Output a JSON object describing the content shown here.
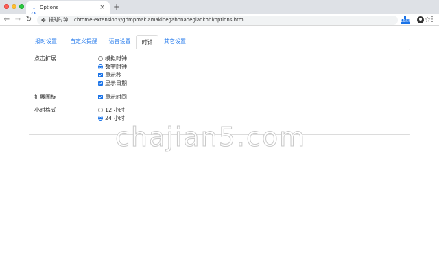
{
  "browser": {
    "tab_title": "Options",
    "tab_favicon": "-()-",
    "new_tab_label": "+",
    "tab_close_label": "×",
    "origin_label": "报时时钟",
    "url": "chrome-extension://gdmpmaklamakipegabonadegiaokhbl/options.html",
    "extension_badge": "16:55"
  },
  "icons": {
    "back": "arrow-left-icon",
    "forward": "arrow-right-icon",
    "reload": "reload-icon",
    "puzzle": "extension-puzzle-icon",
    "star": "star-icon",
    "account": "account-circle-icon",
    "menu": "more-vertical-icon"
  },
  "options_tabs": [
    {
      "label": "报时设置"
    },
    {
      "label": "自定义提醒"
    },
    {
      "label": "语音设置"
    },
    {
      "label": "时钟"
    },
    {
      "label": "其它设置"
    }
  ],
  "active_tab": "时钟",
  "sections": {
    "click_extension": {
      "label": "点击扩展",
      "options": [
        {
          "label": "模拟时钟",
          "type": "radio",
          "checked": false
        },
        {
          "label": "数字时钟",
          "type": "radio",
          "checked": true
        },
        {
          "label": "显示秒",
          "type": "checkbox",
          "checked": true
        },
        {
          "label": "显示日期",
          "type": "checkbox",
          "checked": true
        }
      ]
    },
    "extension_icon": {
      "label": "扩展图标",
      "options": [
        {
          "label": "显示时间",
          "type": "checkbox",
          "checked": true
        }
      ]
    },
    "hour_format": {
      "label": "小时格式",
      "options": [
        {
          "label": "12 小时",
          "type": "radio",
          "checked": false
        },
        {
          "label": "24 小时",
          "type": "radio",
          "checked": true
        }
      ]
    }
  },
  "watermark": "chajian5.com",
  "colors": {
    "accent": "#1a73e8",
    "link": "#2f80ed",
    "titlebar": "#dee1e6"
  }
}
